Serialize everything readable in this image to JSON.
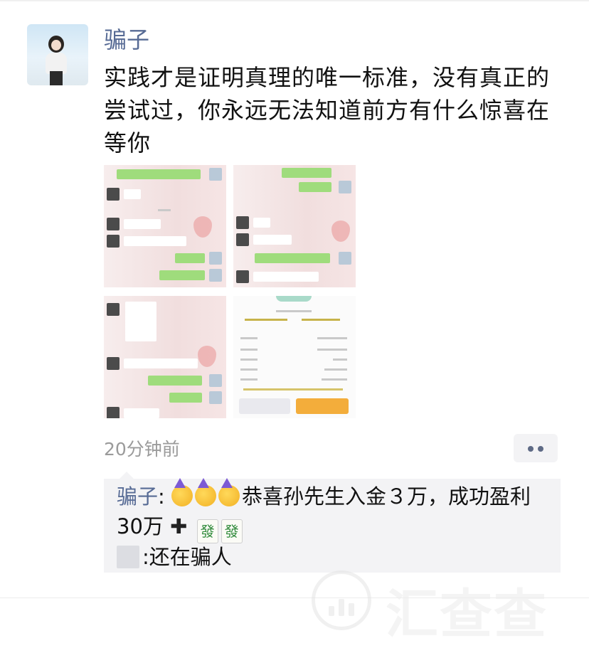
{
  "post": {
    "author": "骗子",
    "text": "实践才是证明真理的唯一标准，没有真正的尝试过，你永远无法知道前方有什么惊喜在等你",
    "time": "20分钟前"
  },
  "comments": [
    {
      "author": "骗子",
      "separator": ":",
      "text_a": "恭喜孙先生入金３万，成功盈利30万",
      "cross": "✚",
      "fa_char": "發"
    },
    {
      "separator": ":",
      "text": "还在骗人"
    }
  ],
  "watermark": {
    "text": "汇查查"
  },
  "icons": {
    "more": "more-dots-icon",
    "emoji": "party-face-emoji",
    "fa": "mahjong-fa-tile"
  }
}
